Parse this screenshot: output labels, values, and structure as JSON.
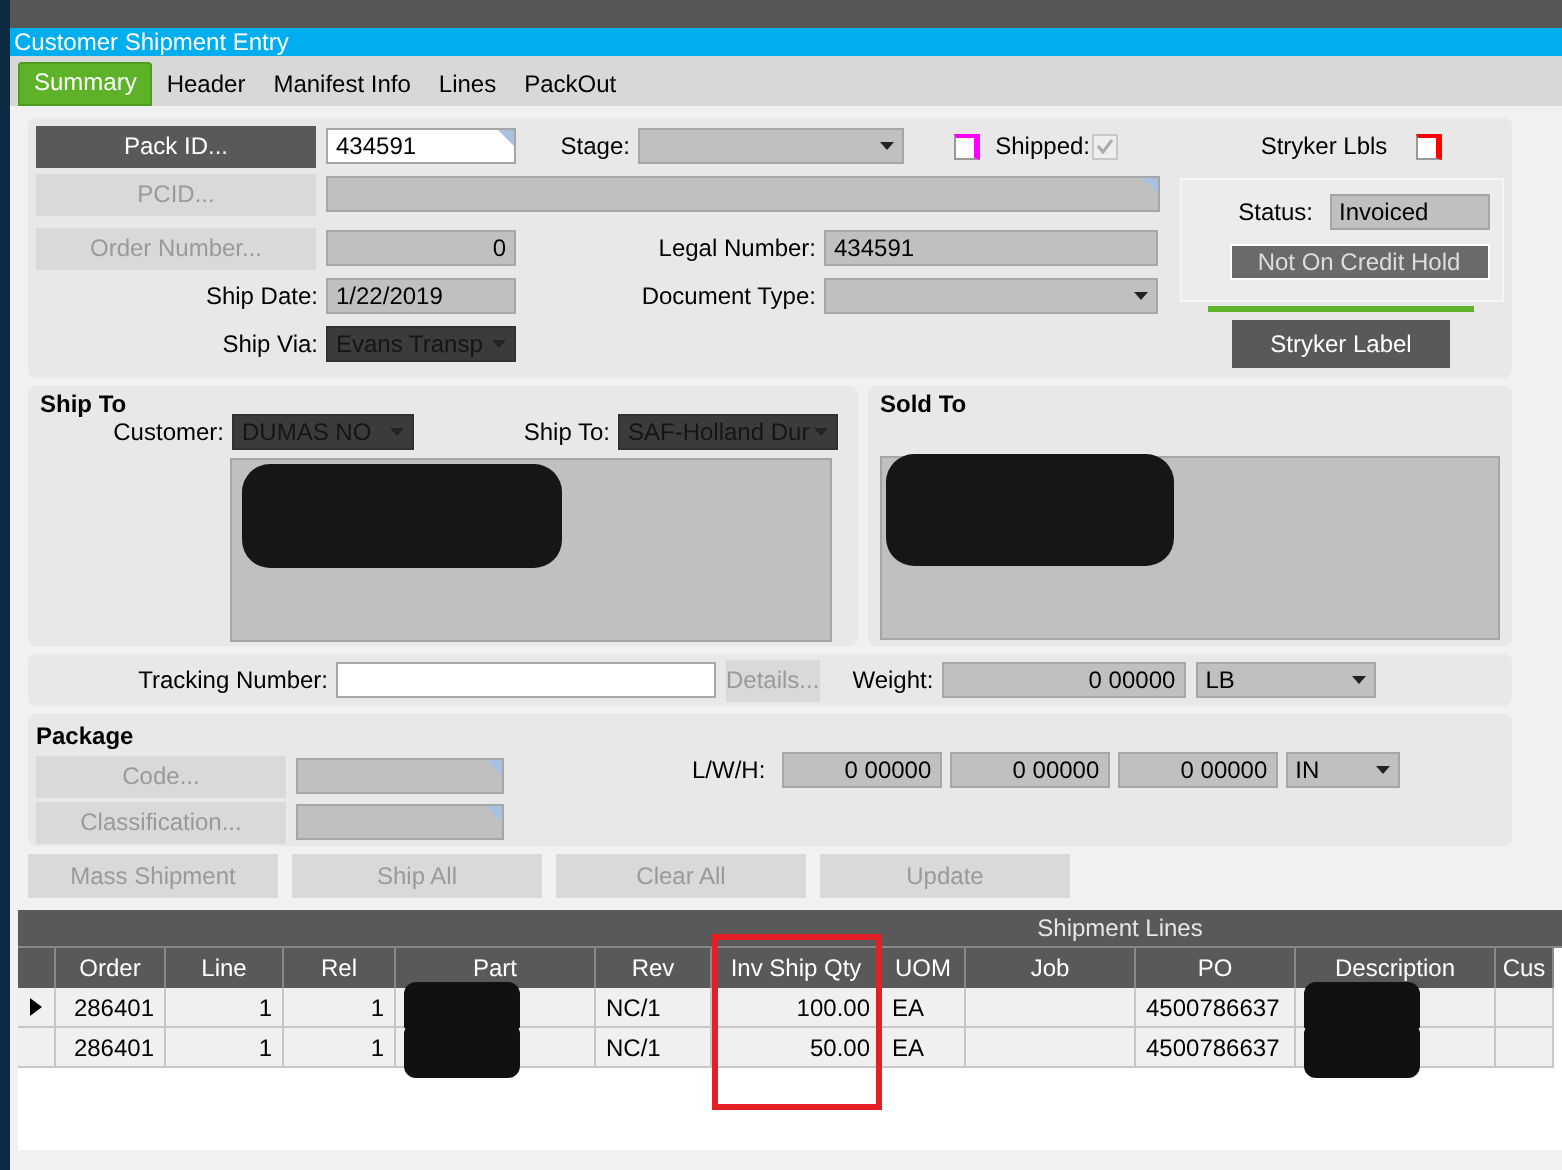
{
  "window": {
    "title": "Customer Shipment Entry"
  },
  "tabs": [
    {
      "label": "Summary",
      "selected": true
    },
    {
      "label": "Header",
      "selected": false
    },
    {
      "label": "Manifest Info",
      "selected": false
    },
    {
      "label": "Lines",
      "selected": false
    },
    {
      "label": "PackOut",
      "selected": false
    }
  ],
  "summary": {
    "pack_id_button": {
      "label": "Pack ID...",
      "disabled": false
    },
    "pack_id": "434591",
    "stage": {
      "label": "Stage:"
    },
    "flag_checkbox": {
      "checked": false
    },
    "shipped": {
      "label": "Shipped:",
      "checked": true
    },
    "pcid_button": {
      "label": "PCID...",
      "disabled": true
    },
    "order_number_button": {
      "label": "Order Number...",
      "disabled": true
    },
    "order_number": "0",
    "legal_number": {
      "label": "Legal Number:",
      "value": "434591"
    },
    "ship_date": {
      "label": "Ship Date:",
      "value": "1/22/2019"
    },
    "document_type": {
      "label": "Document Type:"
    },
    "ship_via": {
      "label": "Ship Via:",
      "value": "Evans Transp",
      "redacted": true
    },
    "stryker_lbls": {
      "label": "Stryker Lbls",
      "checked": false
    },
    "status": {
      "label": "Status:",
      "value": "Invoiced"
    },
    "credit_hold_button": "Not On Credit Hold",
    "stryker_label_button": "Stryker Label"
  },
  "ship_to": {
    "title": "Ship To",
    "customer": {
      "label": "Customer:",
      "value": "DUMAS NO",
      "redacted": true
    },
    "ship_to": {
      "label": "Ship To:",
      "value": "SAF-Holland Dur",
      "redacted": true
    },
    "address_redacted": true
  },
  "sold_to": {
    "title": "Sold To",
    "address_redacted": true
  },
  "tracking": {
    "label": "Tracking Number:",
    "details_button": {
      "label": "Details...",
      "disabled": true
    },
    "weight": {
      "label": "Weight:",
      "value": "0 00000",
      "unit": "LB"
    }
  },
  "package": {
    "title": "Package",
    "code_button": {
      "label": "Code...",
      "disabled": true
    },
    "classification_button": {
      "label": "Classification...",
      "disabled": true
    },
    "lwh": {
      "label": "L/W/H:",
      "values": [
        "0 00000",
        "0 00000",
        "0 00000"
      ],
      "unit": "IN"
    }
  },
  "actions": [
    {
      "label": "Mass Shipment",
      "disabled": true
    },
    {
      "label": "Ship All",
      "disabled": true
    },
    {
      "label": "Clear All",
      "disabled": true
    },
    {
      "label": "Update",
      "disabled": true
    }
  ],
  "grid": {
    "title": "Shipment Lines",
    "columns": [
      {
        "label": "Order",
        "annotated": false
      },
      {
        "label": "Line",
        "annotated": false
      },
      {
        "label": "Rel",
        "annotated": false
      },
      {
        "label": "Part",
        "annotated": false
      },
      {
        "label": "Rev",
        "annotated": false
      },
      {
        "label": "Inv Ship Qty",
        "annotated": true
      },
      {
        "label": "UOM",
        "annotated": false
      },
      {
        "label": "Job",
        "annotated": false
      },
      {
        "label": "PO",
        "annotated": false
      },
      {
        "label": "Description",
        "annotated": false
      },
      {
        "label": "Cus",
        "annotated": false
      }
    ],
    "rows": [
      {
        "current": true,
        "cells": [
          "286401",
          "1",
          "1",
          {
            "redacted": true
          },
          "NC/1",
          "100.00",
          "EA",
          null,
          "4500786637",
          {
            "redacted": true
          },
          null
        ]
      },
      {
        "current": false,
        "cells": [
          "286401",
          "1",
          "1",
          {
            "redacted": true
          },
          "NC/1",
          "50.00",
          "EA",
          null,
          "4500786637",
          {
            "redacted": true
          },
          null
        ]
      }
    ]
  }
}
